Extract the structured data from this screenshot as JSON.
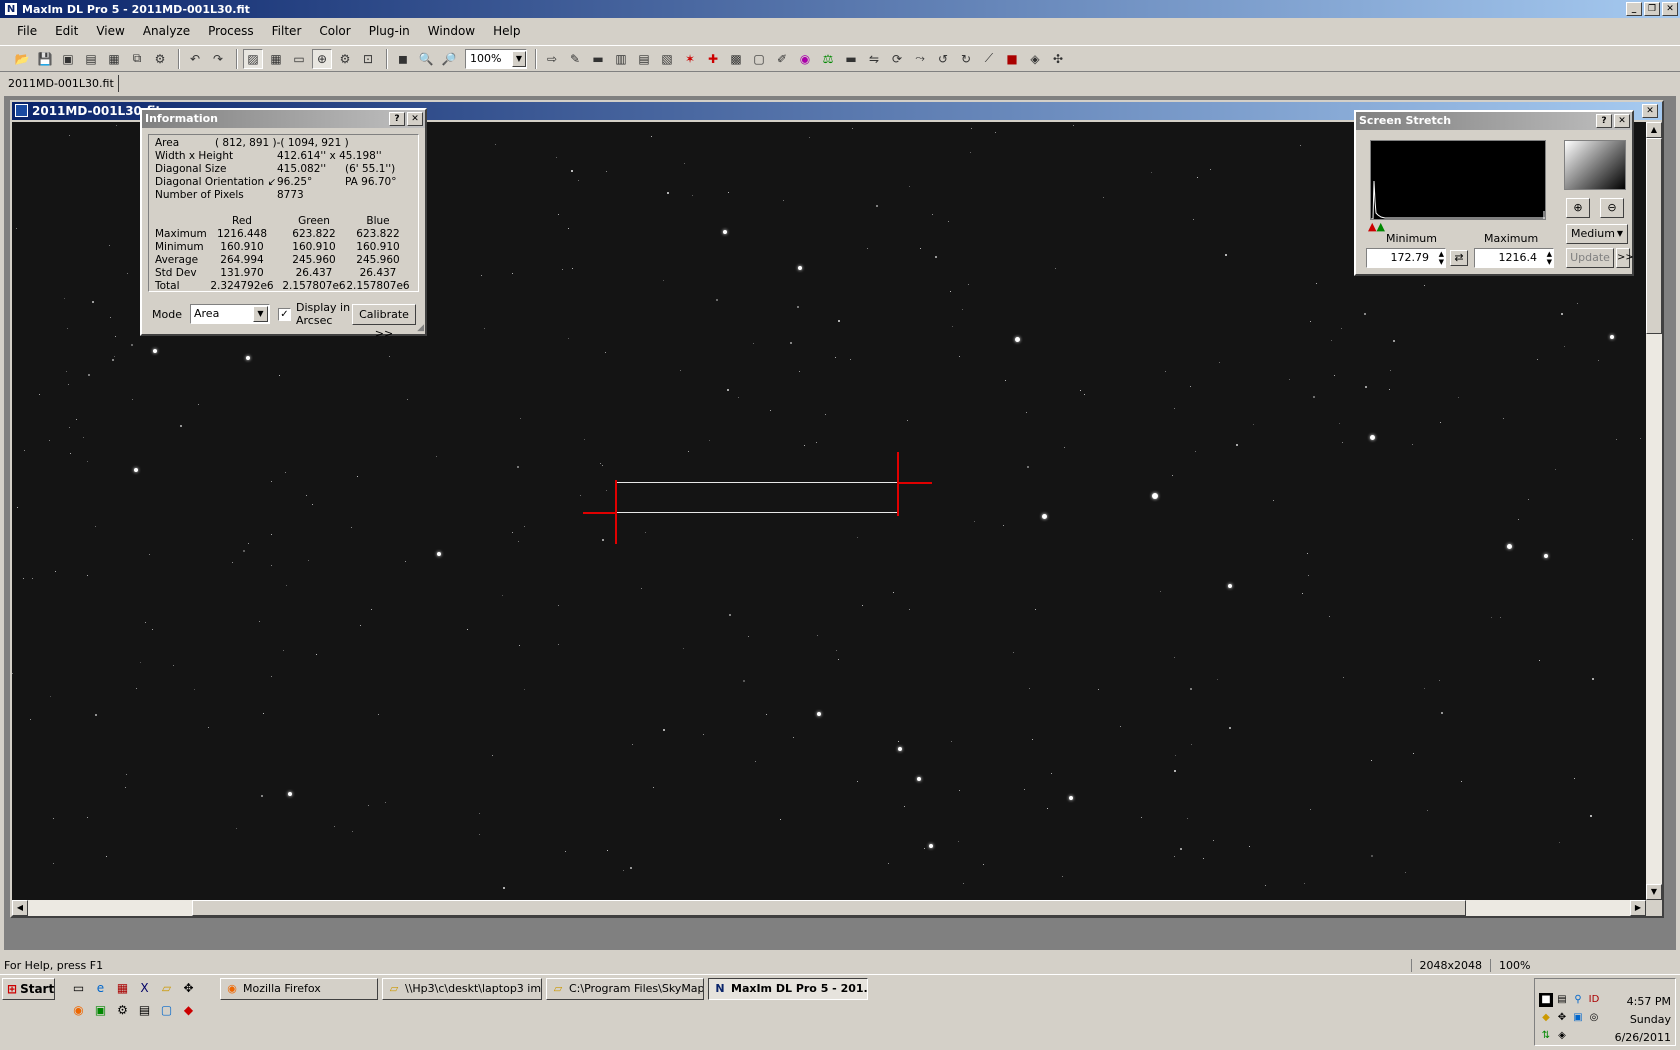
{
  "app": {
    "title": "MaxIm DL Pro 5 - 2011MD-001L30.fit",
    "icon_name": "maxim-icon"
  },
  "window_buttons": {
    "minimize": "_",
    "restore": "❐",
    "close": "✕"
  },
  "menu": [
    "File",
    "Edit",
    "View",
    "Analyze",
    "Process",
    "Filter",
    "Color",
    "Plug-in",
    "Window",
    "Help"
  ],
  "toolbar": {
    "zoom_value": "100%",
    "icons": [
      "open-icon",
      "save-icon",
      "save-all-icon",
      "folder-icon",
      "print-icon",
      "copy-icon",
      "settings-icon",
      "undo-icon",
      "redo-icon",
      "image-icon",
      "thumbnails-icon",
      "window-icon",
      "crosshair-icon",
      "gear-icon",
      "zoom-fit-icon",
      "zoom-box-icon",
      "zoom-in-icon",
      "zoom-out-icon"
    ],
    "icons_right": [
      "arrow-icon",
      "pencil-icon",
      "ruler-icon",
      "chart-icon",
      "stack-icon",
      "align-icon",
      "star-icon",
      "red-cross-icon",
      "gallery-icon",
      "numbers-icon",
      "edit-icon",
      "color-icon",
      "balance-icon",
      "bar-icon",
      "flip-icon",
      "rotate-icon",
      "chart2-icon",
      "rotate-left-icon",
      "rotate-right-icon",
      "graph-icon",
      "camera-icon",
      "map-icon",
      "puzzle-icon"
    ]
  },
  "doc_tab": "2011MD-001L30.fit",
  "image_window": {
    "title": "2011MD-001L30.fit"
  },
  "info_panel": {
    "title": "Information",
    "rows": [
      {
        "label": "Area",
        "value": "( 812, 891 )-( 1094, 921 )"
      },
      {
        "label": "Width x Height",
        "value": "412.614'' x 45.198''"
      },
      {
        "label": "Diagonal Size",
        "value": "415.082''",
        "value2": "(6' 55.1'')"
      },
      {
        "label": "Diagonal Orientation ↙",
        "value": "96.25°",
        "value2": "PA   96.70°"
      },
      {
        "label": "Number of Pixels",
        "value": "8773"
      }
    ],
    "stat_headers": [
      "Red",
      "Green",
      "Blue"
    ],
    "stats": [
      {
        "label": "Maximum",
        "red": "1216.448",
        "green": "623.822",
        "blue": "623.822"
      },
      {
        "label": "Minimum",
        "red": "160.910",
        "green": "160.910",
        "blue": "160.910"
      },
      {
        "label": "Average",
        "red": "264.994",
        "green": "245.960",
        "blue": "245.960"
      },
      {
        "label": "Std Dev",
        "red": "131.970",
        "green": "26.437",
        "blue": "26.437"
      },
      {
        "label": "Total",
        "red": "2.324792e6",
        "green": "2.157807e6",
        "blue": "2.157807e6"
      }
    ],
    "mode_label": "Mode",
    "mode_value": "Area",
    "display_arcsec_label_1": "Display in",
    "display_arcsec_label_2": "Arcsec",
    "display_arcsec_checked": true,
    "calibrate_label": "Calibrate >>"
  },
  "stretch_panel": {
    "title": "Screen Stretch",
    "minimum_label": "Minimum",
    "maximum_label": "Maximum",
    "minimum_value": "172.79",
    "maximum_value": "1216.4",
    "preset": "Medium",
    "update_label": "Update",
    "more_label": ">>"
  },
  "status": {
    "help": "For Help, press F1",
    "dimensions": "2048x2048",
    "zoom": "100%"
  },
  "taskbar": {
    "start": "Start",
    "tasks": [
      {
        "label": "Mozilla Firefox",
        "icon": "firefox-icon",
        "active": false
      },
      {
        "label": "\\\\Hp3\\c\\deskt\\laptop3 im...",
        "icon": "folder-icon",
        "active": false
      },
      {
        "label": "C:\\Program Files\\SkyMap...",
        "icon": "folder-icon",
        "active": false
      },
      {
        "label": "MaxIm DL Pro 5 - 201...",
        "icon": "maxim-icon",
        "active": true
      }
    ],
    "clock_time": "4:57 PM",
    "clock_day": "Sunday",
    "clock_date": "6/26/2011"
  }
}
